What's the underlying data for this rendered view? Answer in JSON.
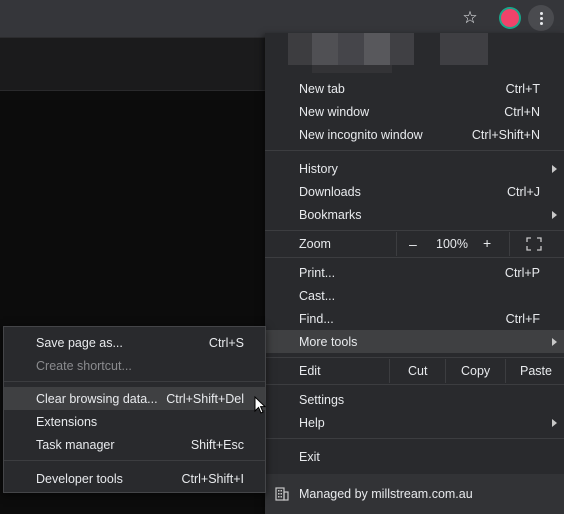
{
  "toolbar": {
    "icons": [
      "star-icon",
      "extension-icon",
      "kebab-menu-icon"
    ]
  },
  "menu": {
    "group1": [
      {
        "label": "New tab",
        "shortcut": "Ctrl+T"
      },
      {
        "label": "New window",
        "shortcut": "Ctrl+N"
      },
      {
        "label": "New incognito window",
        "shortcut": "Ctrl+Shift+N"
      }
    ],
    "group2": [
      {
        "label": "History",
        "shortcut": ""
      },
      {
        "label": "Downloads",
        "shortcut": "Ctrl+J"
      },
      {
        "label": "Bookmarks",
        "shortcut": ""
      }
    ],
    "zoom": {
      "label": "Zoom",
      "minus": "–",
      "value": "100%",
      "plus": "+"
    },
    "group3": [
      {
        "label": "Print...",
        "shortcut": "Ctrl+P"
      },
      {
        "label": "Cast...",
        "shortcut": ""
      },
      {
        "label": "Find...",
        "shortcut": "Ctrl+F"
      },
      {
        "label": "More tools",
        "shortcut": ""
      }
    ],
    "edit": {
      "label": "Edit",
      "cut": "Cut",
      "copy": "Copy",
      "paste": "Paste"
    },
    "group4": [
      {
        "label": "Settings"
      },
      {
        "label": "Help"
      }
    ],
    "exit": "Exit",
    "managed": "Managed by millstream.com.au"
  },
  "submenu": {
    "items": [
      {
        "label": "Save page as...",
        "shortcut": "Ctrl+S"
      },
      {
        "label": "Create shortcut...",
        "shortcut": ""
      },
      {
        "label": "Clear browsing data...",
        "shortcut": "Ctrl+Shift+Del"
      },
      {
        "label": "Extensions",
        "shortcut": ""
      },
      {
        "label": "Task manager",
        "shortcut": "Shift+Esc"
      },
      {
        "label": "Developer tools",
        "shortcut": "Ctrl+Shift+I"
      }
    ]
  },
  "colors": {
    "menu_bg": "#292a2d",
    "highlight": "#3f4042",
    "text": "#e8eaed",
    "disabled": "#8a8b8e"
  }
}
